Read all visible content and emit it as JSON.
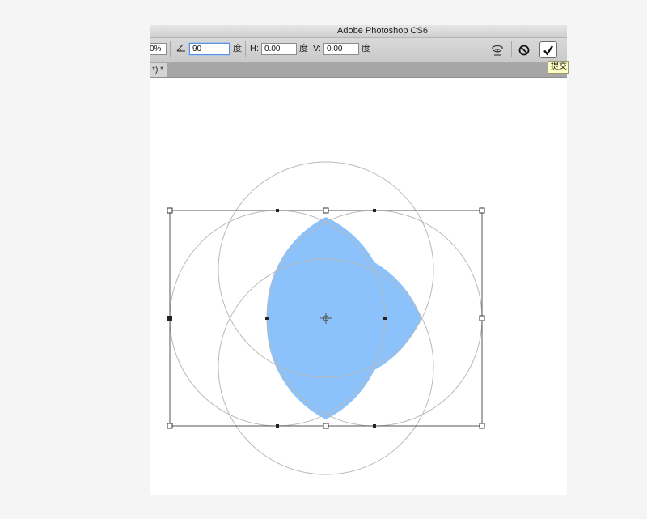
{
  "window": {
    "title": "Adobe Photoshop CS6"
  },
  "options_bar": {
    "scale_partial": "0%",
    "angle_value": "90",
    "angle_unit": "度",
    "h_label": "H:",
    "h_value": "0.00",
    "h_unit": "度",
    "v_label": "V:",
    "v_value": "0.00",
    "v_unit": "度"
  },
  "document_tab": {
    "label": "*) *"
  },
  "tooltip": {
    "text": "提交"
  },
  "colors": {
    "shape_fill": "#8cc2fb",
    "guide_stroke": "#b8b8b8",
    "bbox_stroke": "#555555"
  },
  "icons": {
    "angle": "angle-icon",
    "warp": "warp-mode-icon",
    "cancel": "cancel-transform-icon",
    "commit": "commit-checkmark-icon"
  }
}
